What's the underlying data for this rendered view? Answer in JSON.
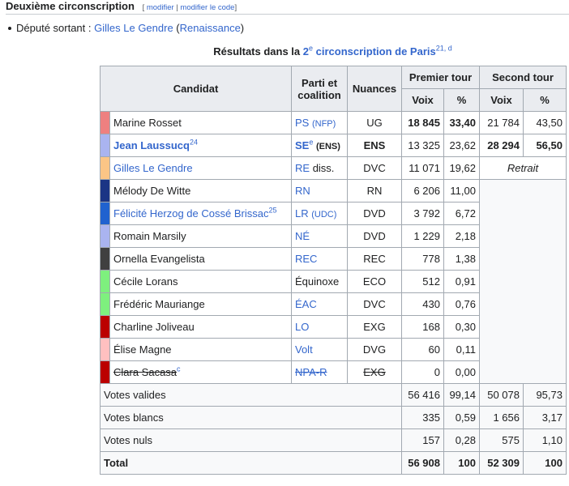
{
  "heading": {
    "title": "Deuxième circonscription",
    "edit_open": "[",
    "edit_link1": "modifier",
    "edit_sep": "|",
    "edit_link2": "modifier le code",
    "edit_close": "]"
  },
  "bullet": {
    "prefix": "Député sortant : ",
    "person": "Gilles Le Gendre",
    "party_open": " (",
    "party": "Renaissance",
    "party_close": ")"
  },
  "caption": {
    "prefix": "Résultats dans la ",
    "link_num": "2",
    "link_sup": "e",
    "link_rest": " circonscription de Paris",
    "note": "21, d"
  },
  "headers": {
    "candidat": "Candidat",
    "parti": "Parti et coalition",
    "nuances": "Nuances",
    "premier": "Premier tour",
    "second": "Second tour",
    "voix": "Voix",
    "pct": "%"
  },
  "rows": [
    {
      "color": "#ee8080",
      "name": "Marine Rosset",
      "party": "PS",
      "coalition": "(NFP)",
      "nuance": "UG",
      "v1": "18 845",
      "p1": "33,40",
      "v2": "21 784",
      "p2": "43,50"
    },
    {
      "color": "#aab4f0",
      "name": "Jean Laussucq",
      "note": "24",
      "party": "SE",
      "party_sup": "e",
      "coalition": "(ENS)",
      "nuance": "ENS",
      "v1": "13 325",
      "p1": "23,62",
      "v2": "28 294",
      "p2": "56,50"
    },
    {
      "color": "#fbc586",
      "name": "Gilles Le Gendre",
      "party": "RE",
      "party_extra": "diss.",
      "nuance": "DVC",
      "v1": "11 071",
      "p1": "19,62",
      "status": "Retrait"
    },
    {
      "color": "#1b3585",
      "name": "Mélody De Witte",
      "party": "RN",
      "nuance": "RN",
      "v1": "6 206",
      "p1": "11,00"
    },
    {
      "color": "#2062cf",
      "name": "Félicité Herzog de Cossé Brissac",
      "note": "25",
      "party": "LR",
      "coalition": "(UDC)",
      "nuance": "DVD",
      "v1": "3 792",
      "p1": "6,72"
    },
    {
      "color": "#aab4f0",
      "name": "Romain Marsily",
      "party": "NÉ",
      "nuance": "DVD",
      "v1": "1 229",
      "p1": "2,18"
    },
    {
      "color": "#404040",
      "name": "Ornella Evangelista",
      "party": "REC",
      "nuance": "REC",
      "v1": "778",
      "p1": "1,38"
    },
    {
      "color": "#7ef07e",
      "name": "Cécile Lorans",
      "party": "Équinoxe",
      "nuance": "ECO",
      "v1": "512",
      "p1": "0,91"
    },
    {
      "color": "#7ef07e",
      "name": "Frédéric Mauriange",
      "party": "ÉAC",
      "nuance": "DVC",
      "v1": "430",
      "p1": "0,76"
    },
    {
      "color": "#bb0000",
      "name": "Charline Joliveau",
      "party": "LO",
      "nuance": "EXG",
      "v1": "168",
      "p1": "0,30"
    },
    {
      "color": "#ffc0c0",
      "name": "Élise Magne",
      "party": "Volt",
      "nuance": "DVG",
      "v1": "60",
      "p1": "0,11"
    },
    {
      "color": "#bb0000",
      "name": "Clara Sacasa",
      "note": "c",
      "party": "NPA-R",
      "nuance": "EXG",
      "v1": "0",
      "p1": "0,00"
    }
  ],
  "summary": [
    {
      "label": "Votes valides",
      "v1": "56 416",
      "p1": "99,14",
      "v2": "50 078",
      "p2": "95,73"
    },
    {
      "label": "Votes blancs",
      "v1": "335",
      "p1": "0,59",
      "v2": "1 656",
      "p2": "3,17"
    },
    {
      "label": "Votes nuls",
      "v1": "157",
      "p1": "0,28",
      "v2": "575",
      "p2": "1,10"
    },
    {
      "label": "Total",
      "v1": "56 908",
      "p1": "100",
      "v2": "52 309",
      "p2": "100"
    }
  ]
}
